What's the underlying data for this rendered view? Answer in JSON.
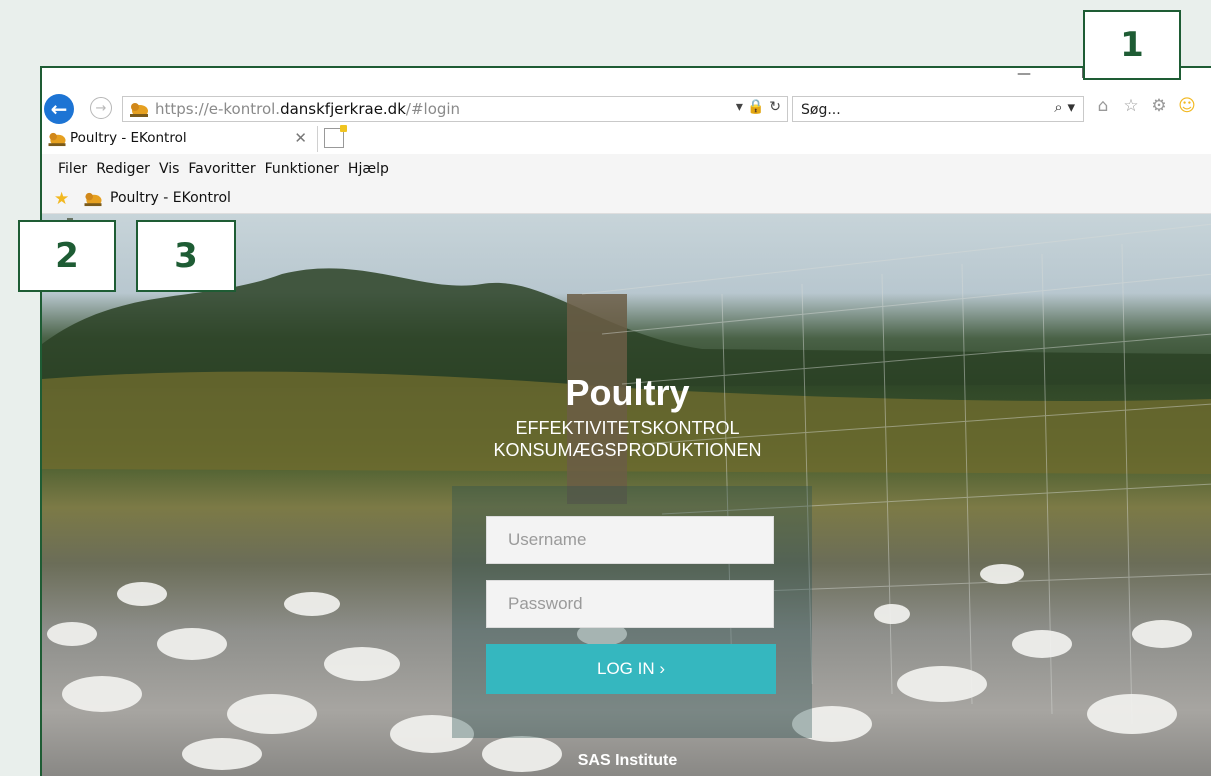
{
  "browser": {
    "url_prefix": "https://e-kontrol.",
    "url_domain": "danskfjerkrae.dk",
    "url_suffix": "/#login",
    "url_tools": "▾ 🔒 ↻",
    "search_placeholder": "Søg...",
    "search_icon": "⌕ ▾",
    "window_controls": [
      "—",
      "☐",
      "✕"
    ],
    "toolbar_icons": [
      "home-icon",
      "favorites-star-icon",
      "settings-gear-icon",
      "smiley-feedback-icon"
    ],
    "tab": {
      "label": "Poultry - EKontrol",
      "close": "✕"
    },
    "menu": [
      "Filer",
      "Rediger",
      "Vis",
      "Favoritter",
      "Funktioner",
      "Hjælp"
    ],
    "favorites_bar": {
      "item_label": "Poultry - EKontrol"
    }
  },
  "page": {
    "title": "Poultry",
    "subtitle_line1": "EFFEKTIVITETSKONTROL",
    "subtitle_line2": "KONSUMÆGSPRODUKTIONEN",
    "login": {
      "username_placeholder": "Username",
      "password_placeholder": "Password",
      "button_label": "LOG IN  ›"
    },
    "footer": "SAS Institute"
  },
  "callouts": [
    "1",
    "2",
    "3"
  ],
  "colors": {
    "frame_green": "#1e5c34",
    "login_button": "#35b7bf",
    "back_button": "#1d74d4"
  }
}
